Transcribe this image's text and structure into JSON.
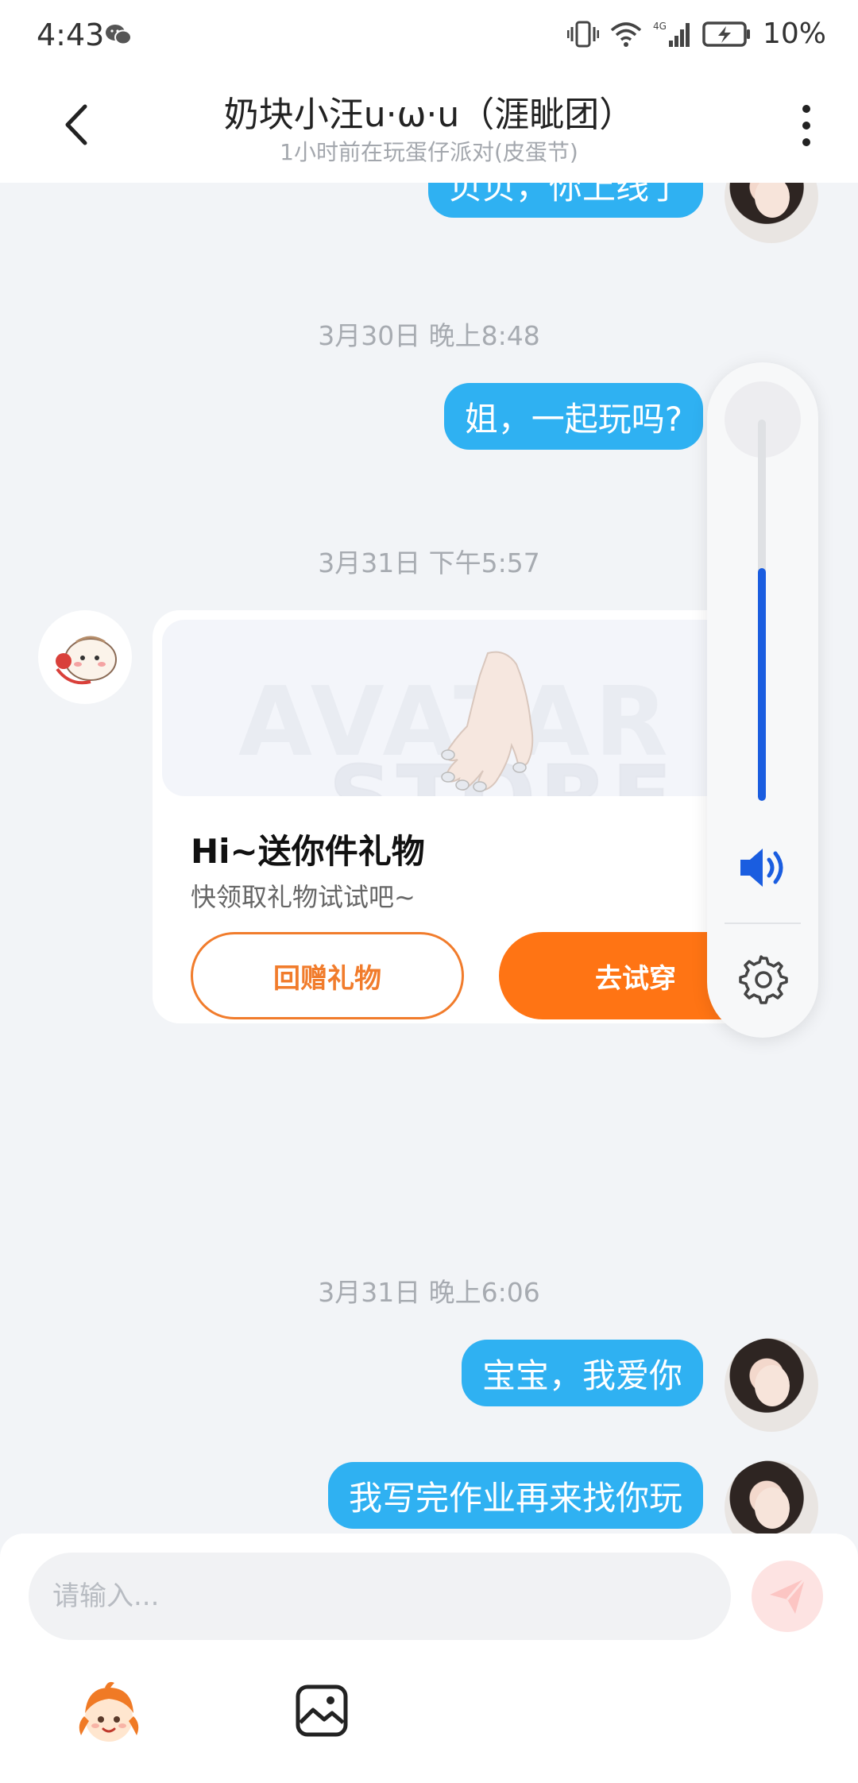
{
  "status_bar": {
    "time": "4:43",
    "battery_text": "10%",
    "network": "4G"
  },
  "header": {
    "title": "奶块小汪u·ω·u（涯眦团）",
    "subtitle": "1小时前在玩蛋仔派对(皮蛋节)"
  },
  "messages": {
    "partial_out": "贝贝，你上线了",
    "ts_1": "3月30日 晚上8:48",
    "out_1": "姐，一起玩吗?",
    "ts_2": "3月31日 下午5:57",
    "ts_3": "3月31日 晚上6:06",
    "out_2": "宝宝，我爱你",
    "out_3": "我写完作业再来找你玩"
  },
  "gift_card": {
    "watermark_1": "AVATAR",
    "watermark_2": "STORE",
    "title": "Hi~送你件礼物",
    "description": "快领取礼物试试吧~",
    "return_gift_label": "回赠礼物",
    "try_on_label": "去试穿"
  },
  "volume": {
    "level": 0.61,
    "accent_color": "#1a5de0"
  },
  "input": {
    "placeholder": "请输入..."
  },
  "colors": {
    "bubble_out": "#2fb1f2",
    "orange": "#ff7414",
    "background": "#f2f4f7"
  }
}
